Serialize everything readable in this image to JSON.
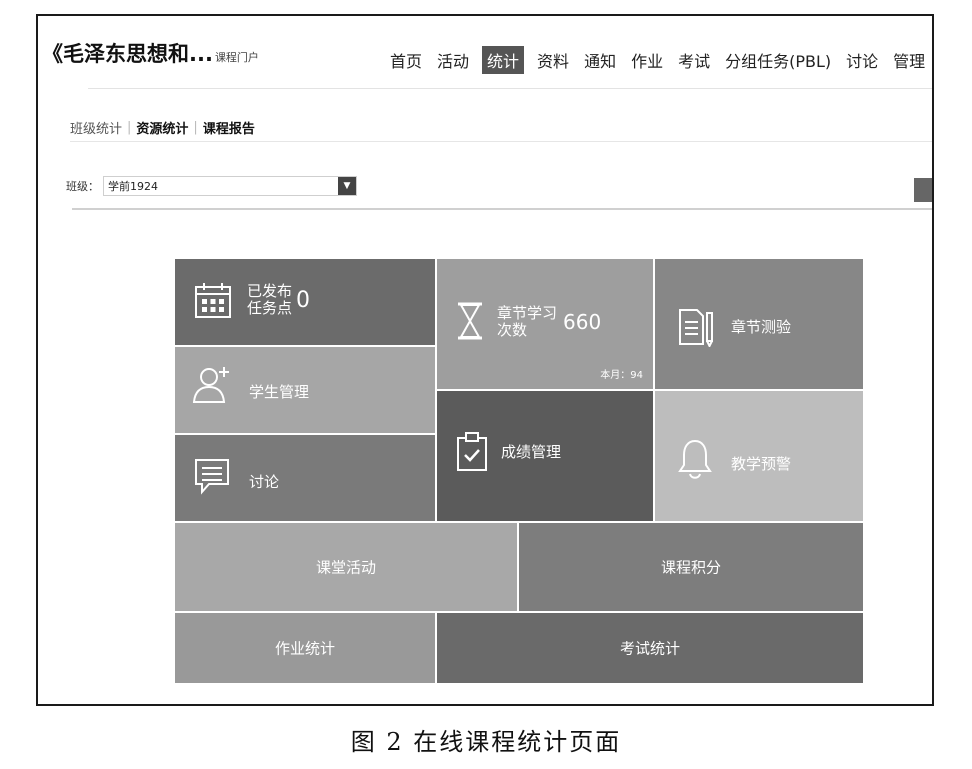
{
  "header": {
    "course_title": "《毛泽东思想和...",
    "course_subtitle": "课程门户",
    "nav": [
      "首页",
      "活动",
      "统计",
      "资料",
      "通知",
      "作业",
      "考试",
      "分组任务(PBL)",
      "讨论",
      "管理"
    ],
    "active_nav": "统计"
  },
  "subtabs": {
    "class_stats": "班级统计",
    "resource_stats": "资源统计",
    "course_report": "课程报告"
  },
  "class_select": {
    "label": "班级：",
    "value": "学前1924"
  },
  "tiles": {
    "published": {
      "label_line1": "已发布",
      "label_line2": "任务点",
      "value": "0",
      "icon": "calendar-icon"
    },
    "chapter_study": {
      "label_line1": "章节学习",
      "label_line2": "次数",
      "value": "660",
      "month": "本月：94",
      "icon": "hourglass-icon"
    },
    "chapter_quiz": {
      "label": "章节测验",
      "icon": "document-pencil-icon"
    },
    "student_mgmt": {
      "label": "学生管理",
      "icon": "add-user-icon"
    },
    "grade_mgmt": {
      "label": "成绩管理",
      "icon": "clipboard-check-icon"
    },
    "teaching_alert": {
      "label": "教学预警",
      "icon": "bell-icon"
    },
    "discussion": {
      "label": "讨论",
      "icon": "chat-icon"
    },
    "class_activity": {
      "label": "课堂活动"
    },
    "course_points": {
      "label": "课程积分"
    },
    "homework_stats": {
      "label": "作业统计"
    },
    "exam_stats": {
      "label": "考试统计"
    }
  },
  "caption": "图 2   在线课程统计页面"
}
